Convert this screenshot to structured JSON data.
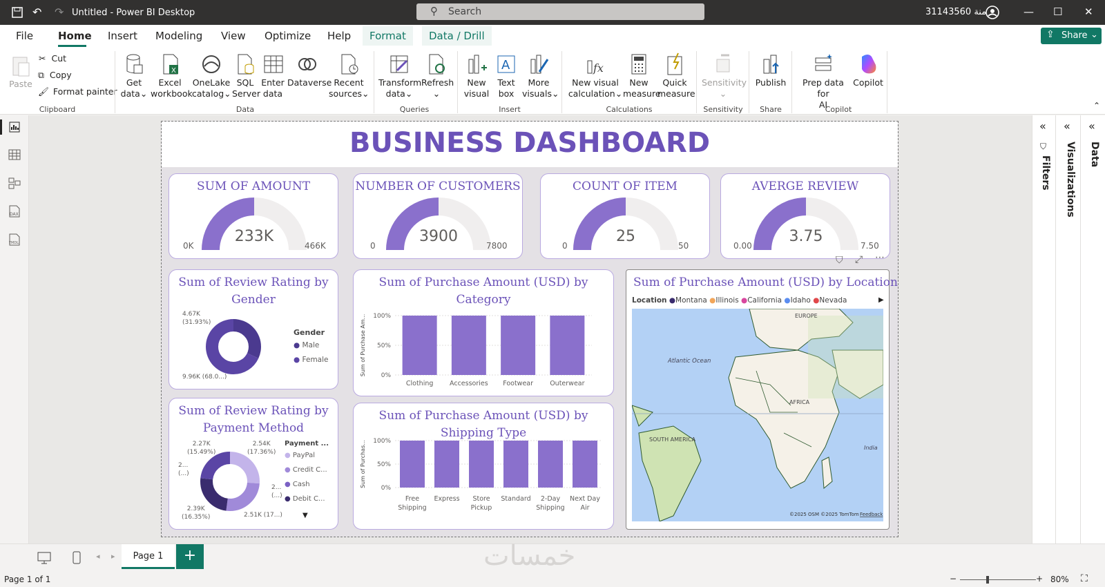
{
  "titlebar": {
    "title": "Untitled - Power BI Desktop",
    "search": "Search",
    "user": "31143560 منة"
  },
  "menu": {
    "tabs": [
      "File",
      "Home",
      "Insert",
      "Modeling",
      "View",
      "Optimize",
      "Help",
      "Format",
      "Data / Drill"
    ],
    "share": "Share"
  },
  "ribbon": {
    "clipboard": {
      "paste": "Paste",
      "cut": "Cut",
      "copy": "Copy",
      "format_painter": "Format painter",
      "group": "Clipboard"
    },
    "data": {
      "get_data": [
        "Get",
        "data"
      ],
      "excel": [
        "Excel",
        "workbook"
      ],
      "onelake": [
        "OneLake",
        "catalog"
      ],
      "sql": [
        "SQL",
        "Server"
      ],
      "enter": [
        "Enter",
        "data"
      ],
      "dataverse": "Dataverse",
      "recent": [
        "Recent",
        "sources"
      ],
      "group": "Data"
    },
    "queries": {
      "transform": [
        "Transform",
        "data"
      ],
      "refresh": "Refresh",
      "group": "Queries"
    },
    "insert": {
      "new_visual": [
        "New",
        "visual"
      ],
      "text_box": [
        "Text",
        "box"
      ],
      "more_visuals": [
        "More",
        "visuals"
      ],
      "group": "Insert"
    },
    "calculations": {
      "new_visual_calc": [
        "New visual",
        "calculation"
      ],
      "new_measure": [
        "New",
        "measure"
      ],
      "quick_measure": [
        "Quick",
        "measure"
      ],
      "group": "Calculations"
    },
    "sensitivity": {
      "label": "Sensitivity",
      "group": "Sensitivity"
    },
    "share": {
      "publish": "Publish",
      "group": "Share"
    },
    "copilot": {
      "prep": [
        "Prep data for",
        "AI"
      ],
      "copilot": "Copilot",
      "group": "Copilot"
    }
  },
  "report": {
    "title": "BUSINESS DASHBOARD",
    "kpis": [
      {
        "title": "SUM OF AMOUNT",
        "value": "233K",
        "min": "0K",
        "max": "466K",
        "fraction": 0.5
      },
      {
        "title": "NUMBER OF CUSTOMERS",
        "value": "3900",
        "min": "0",
        "max": "7800",
        "fraction": 0.5
      },
      {
        "title": "COUNT OF ITEM",
        "value": "25",
        "min": "0",
        "max": "50",
        "fraction": 0.5
      },
      {
        "title": "AVERGE REVIEW",
        "value": "3.75",
        "min": "0.00",
        "max": "7.50",
        "fraction": 0.5
      }
    ],
    "gender": {
      "title": [
        "Sum of Review Rating by",
        "Gender"
      ],
      "legend_title": "Gender",
      "legend": [
        "Male",
        "Female"
      ],
      "label_top": [
        "4.67K",
        "(31.93%)"
      ],
      "label_bottom": "9.96K (68.0...)"
    },
    "payment": {
      "title": [
        "Sum of Review Rating by",
        "Payment Method"
      ],
      "legend_title": "Payment ...",
      "legend": [
        "PayPal",
        "Credit C...",
        "Cash",
        "Debit C..."
      ],
      "labels": {
        "a": [
          "2.27K",
          "(15.49%)"
        ],
        "b": [
          "2.54K",
          "(17.36%)"
        ],
        "c": [
          "2...",
          "(...)"
        ],
        "d": [
          "2...",
          "(...)"
        ],
        "e": [
          "2.39K",
          "(16.35%)"
        ],
        "f": "2.51K (17...)"
      }
    },
    "category": {
      "title": [
        "Sum of Purchase Amount (USD) by",
        "Category"
      ],
      "ylabel": "Sum of Purchase Am..."
    },
    "shipping": {
      "title": [
        "Sum of Purchase Amount (USD) by",
        "Shipping Type"
      ],
      "ylabel": "Sum of Purchas..."
    },
    "map": {
      "title": "Sum of Purchase Amount (USD) by Location",
      "legend_title": "Location",
      "legend": [
        "Montana",
        "Illinois",
        "California",
        "Idaho",
        "Nevada"
      ],
      "labels": {
        "europe": "EUROPE",
        "africa": "AFRICA",
        "sa": "SOUTH AMERICA",
        "atl": "Atlantic Ocean",
        "india": "India"
      },
      "attrib": "©2025 OSM  ©2025 TomTom",
      "feedback": "Feedback"
    }
  },
  "chart_data": [
    {
      "type": "bar",
      "title": "Sum of Purchase Amount (USD) by Category",
      "ylabel": "Sum of Purchase Am...",
      "categories": [
        "Clothing",
        "Accessories",
        "Footwear",
        "Outerwear"
      ],
      "values": [
        100,
        100,
        100,
        100
      ],
      "yticks": [
        "100%",
        "50%",
        "0%"
      ],
      "ylim": [
        0,
        100
      ]
    },
    {
      "type": "bar",
      "title": "Sum of Purchase Amount (USD) by Shipping Type",
      "ylabel": "Sum of Purchas...",
      "categories": [
        "Free Shipping",
        "Express",
        "Store Pickup",
        "Standard",
        "2-Day Shipping",
        "Next Day Air"
      ],
      "values": [
        100,
        100,
        100,
        100,
        100,
        100
      ],
      "yticks": [
        "100%",
        "50%",
        "0%"
      ],
      "ylim": [
        0,
        100
      ]
    },
    {
      "type": "pie",
      "title": "Sum of Review Rating by Gender",
      "categories": [
        "Male",
        "Female"
      ],
      "values": [
        4.67,
        9.96
      ]
    },
    {
      "type": "pie",
      "title": "Sum of Review Rating by Payment Method",
      "categories": [
        "PayPal",
        "Credit C...",
        "Cash",
        "Debit C..."
      ],
      "values": [
        2.54,
        2.51,
        2.39,
        2.27
      ]
    }
  ],
  "panes": {
    "filters": "Filters",
    "visualizations": "Visualizations",
    "data": "Data"
  },
  "pages": {
    "tab": "Page 1",
    "add": "+"
  },
  "status": {
    "page": "Page 1 of 1",
    "zoom": "80%"
  },
  "watermark": "خمسات",
  "colors": {
    "accent": "#6b52b8",
    "bar": "#8a70cc",
    "dark": "#4b3a8f"
  }
}
